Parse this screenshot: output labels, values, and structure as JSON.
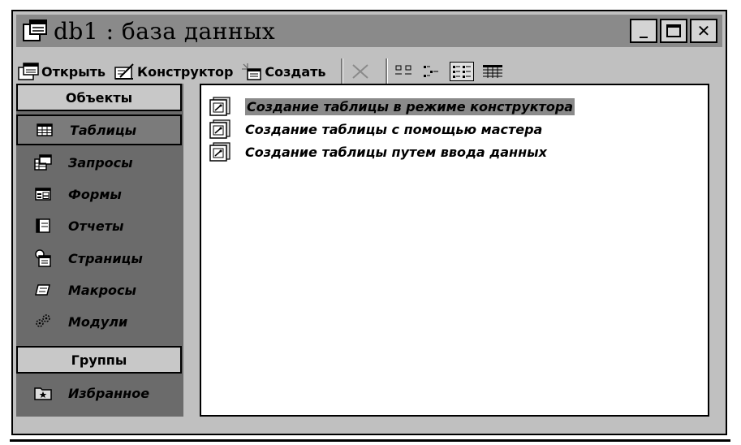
{
  "window": {
    "title": "db1 : база данных",
    "controls": {
      "minimize": "_",
      "close": "✕"
    }
  },
  "toolbar": {
    "open_label": "Открыть",
    "design_label": "Конструктор",
    "create_label": "Создать"
  },
  "objects_header": "Объекты",
  "objects": [
    {
      "label": "Таблицы",
      "icon": "table-icon"
    },
    {
      "label": "Запросы",
      "icon": "query-icon"
    },
    {
      "label": "Формы",
      "icon": "form-icon"
    },
    {
      "label": "Отчеты",
      "icon": "report-icon"
    },
    {
      "label": "Страницы",
      "icon": "page-icon"
    },
    {
      "label": "Макросы",
      "icon": "macro-icon"
    },
    {
      "label": "Модули",
      "icon": "module-icon"
    }
  ],
  "groups_header": "Группы",
  "groups": [
    {
      "label": "Избранное",
      "icon": "favorites-icon"
    }
  ],
  "list": [
    {
      "label": "Создание таблицы в режиме конструктора",
      "icon": "wizard-icon"
    },
    {
      "label": "Создание таблицы с помощью мастера",
      "icon": "wizard-icon"
    },
    {
      "label": "Создание таблицы путем ввода данных",
      "icon": "wizard-icon"
    }
  ]
}
